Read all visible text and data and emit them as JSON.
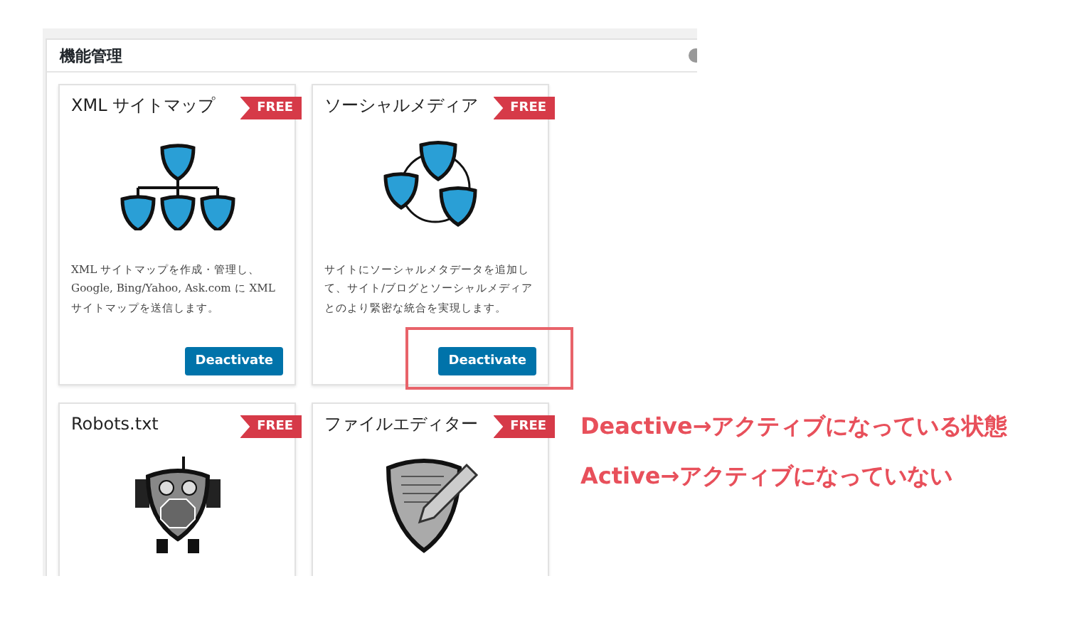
{
  "panel": {
    "title": "機能管理"
  },
  "modules": [
    {
      "kind": "sitemap",
      "title": "XML サイトマップ",
      "badge": "FREE",
      "description": "XML サイトマップを作成・管理し、Google, Bing/Yahoo, Ask.com に XML サイトマップを送信します。",
      "button": "Deactivate",
      "highlighted": false
    },
    {
      "kind": "social",
      "title": "ソーシャルメディア",
      "badge": "FREE",
      "description": "サイトにソーシャルメタデータを追加して、サイト/ブログとソーシャルメディアとのより緊密な統合を実現します。",
      "button": "Deactivate",
      "highlighted": true
    },
    {
      "kind": "robots",
      "title": "Robots.txt",
      "badge": "FREE"
    },
    {
      "kind": "editor",
      "title": "ファイルエディター",
      "badge": "FREE"
    }
  ],
  "annotations": [
    "Deactive→アクティブになっている状態",
    "Active→アクティブになっていない"
  ]
}
